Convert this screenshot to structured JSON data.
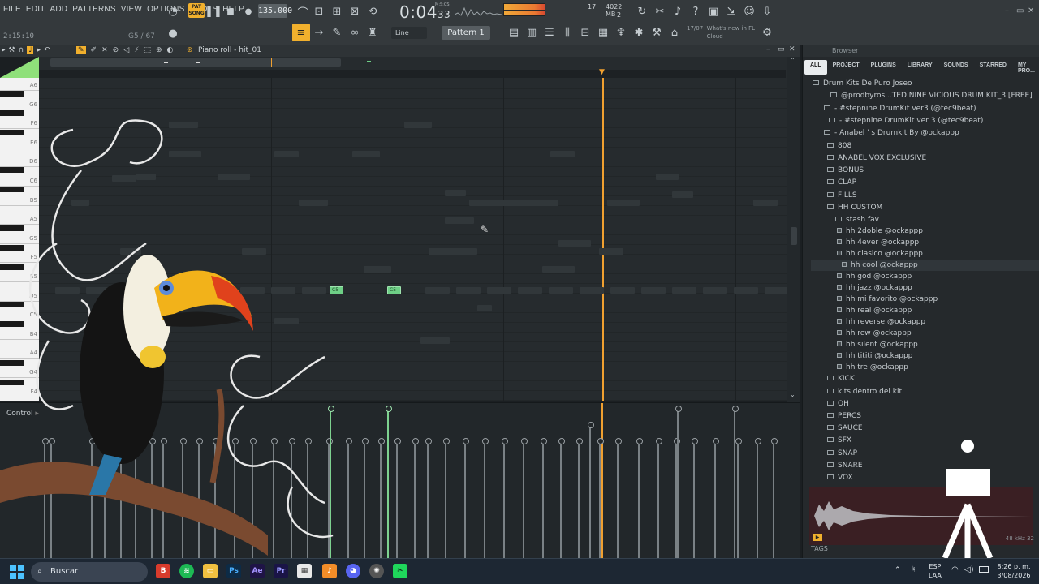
{
  "menu": [
    "FILE",
    "EDIT",
    "ADD",
    "PATTERNS",
    "VIEW",
    "OPTIONS",
    "TOOLS",
    "HELP"
  ],
  "transport": {
    "pat_song": "PAT SONG",
    "tempo": "135.000",
    "time_main": "0:04",
    "time_sub": "33",
    "time_label": "M:S:CS"
  },
  "status": {
    "hint_left": "2:15:10",
    "hint_mid": "G5 / 67",
    "cpu": "17",
    "memory": "4022 MB",
    "voices": "2"
  },
  "toolbar": {
    "snap": "Line",
    "pattern": "Pattern 1",
    "news_date": "17/07",
    "news_text": "What's new in FL Cloud"
  },
  "piano_roll": {
    "title": "Piano roll - hit_01",
    "bar_numbers": [
      "2",
      "3",
      "4"
    ],
    "key_labels": [
      "A6",
      "G6",
      "F6",
      "E6",
      "D6",
      "C6",
      "B5",
      "A5",
      "G5",
      "F5",
      "E5",
      "D5",
      "C5",
      "B4",
      "A4",
      "G4",
      "F4",
      "E4",
      "D4"
    ],
    "notes": [
      {
        "label": "C5"
      },
      {
        "label": "C5"
      }
    ]
  },
  "control": {
    "label": "Control"
  },
  "browser": {
    "header": "Browser",
    "tabs": [
      "ALL",
      "PROJECT",
      "PLUGINS",
      "LIBRARY",
      "SOUNDS",
      "STARRED",
      "MY PRO..."
    ],
    "tree": [
      "Drum Kits De Puro Joseo",
      "@prodbyros...TED NINE VICIOUS DRUM KIT_3 [FREE]",
      "- #stepnine.DrumKit ver3 (@tec9beat)",
      "- #stepnine.DrumKit ver 3 (@tec9beat)",
      "- Anabel ' s Drumkit By @ockappp",
      "808",
      "ANABEL VOX EXCLUSIVE",
      "BONUS",
      "CLAP",
      "FILLS",
      "HH CUSTOM",
      "stash fav",
      "hh 2doble @ockappp",
      "hh 4ever @ockappp",
      "hh clasico @ockappp",
      "hh cool @ockappp",
      "hh god @ockappp",
      "hh jazz @ockappp",
      "hh mi favorito @ockappp",
      "hh real @ockappp",
      "hh reverse @ockappp",
      "hh rew @ockappp",
      "hh silent @ockappp",
      "hh tititi @ockappp",
      "hh tre @ockappp",
      "KICK",
      "kits dentro del kit",
      "OH",
      "PERCS",
      "SAUCE",
      "SFX",
      "SNAP",
      "SNARE",
      "VOX"
    ],
    "tags": "TAGS",
    "sample_info": "48 kHz 32"
  },
  "taskbar": {
    "search": "Buscar",
    "lang_top": "ESP",
    "lang_bottom": "LAA",
    "clock_time": "8:26 p. m.",
    "clock_date": "3/08/2026"
  },
  "colors": {
    "note": "#6ecf86",
    "playhead": "#f0a030",
    "accent": "#f1b02d"
  }
}
